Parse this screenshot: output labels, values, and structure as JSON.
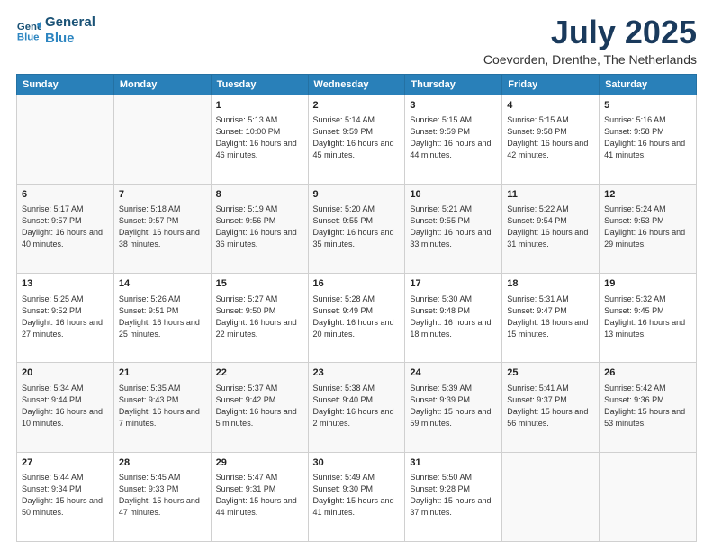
{
  "logo": {
    "line1": "General",
    "line2": "Blue"
  },
  "title": "July 2025",
  "subtitle": "Coevorden, Drenthe, The Netherlands",
  "days_header": [
    "Sunday",
    "Monday",
    "Tuesday",
    "Wednesday",
    "Thursday",
    "Friday",
    "Saturday"
  ],
  "weeks": [
    [
      {
        "day": "",
        "content": ""
      },
      {
        "day": "",
        "content": ""
      },
      {
        "day": "1",
        "content": "Sunrise: 5:13 AM\nSunset: 10:00 PM\nDaylight: 16 hours and 46 minutes."
      },
      {
        "day": "2",
        "content": "Sunrise: 5:14 AM\nSunset: 9:59 PM\nDaylight: 16 hours and 45 minutes."
      },
      {
        "day": "3",
        "content": "Sunrise: 5:15 AM\nSunset: 9:59 PM\nDaylight: 16 hours and 44 minutes."
      },
      {
        "day": "4",
        "content": "Sunrise: 5:15 AM\nSunset: 9:58 PM\nDaylight: 16 hours and 42 minutes."
      },
      {
        "day": "5",
        "content": "Sunrise: 5:16 AM\nSunset: 9:58 PM\nDaylight: 16 hours and 41 minutes."
      }
    ],
    [
      {
        "day": "6",
        "content": "Sunrise: 5:17 AM\nSunset: 9:57 PM\nDaylight: 16 hours and 40 minutes."
      },
      {
        "day": "7",
        "content": "Sunrise: 5:18 AM\nSunset: 9:57 PM\nDaylight: 16 hours and 38 minutes."
      },
      {
        "day": "8",
        "content": "Sunrise: 5:19 AM\nSunset: 9:56 PM\nDaylight: 16 hours and 36 minutes."
      },
      {
        "day": "9",
        "content": "Sunrise: 5:20 AM\nSunset: 9:55 PM\nDaylight: 16 hours and 35 minutes."
      },
      {
        "day": "10",
        "content": "Sunrise: 5:21 AM\nSunset: 9:55 PM\nDaylight: 16 hours and 33 minutes."
      },
      {
        "day": "11",
        "content": "Sunrise: 5:22 AM\nSunset: 9:54 PM\nDaylight: 16 hours and 31 minutes."
      },
      {
        "day": "12",
        "content": "Sunrise: 5:24 AM\nSunset: 9:53 PM\nDaylight: 16 hours and 29 minutes."
      }
    ],
    [
      {
        "day": "13",
        "content": "Sunrise: 5:25 AM\nSunset: 9:52 PM\nDaylight: 16 hours and 27 minutes."
      },
      {
        "day": "14",
        "content": "Sunrise: 5:26 AM\nSunset: 9:51 PM\nDaylight: 16 hours and 25 minutes."
      },
      {
        "day": "15",
        "content": "Sunrise: 5:27 AM\nSunset: 9:50 PM\nDaylight: 16 hours and 22 minutes."
      },
      {
        "day": "16",
        "content": "Sunrise: 5:28 AM\nSunset: 9:49 PM\nDaylight: 16 hours and 20 minutes."
      },
      {
        "day": "17",
        "content": "Sunrise: 5:30 AM\nSunset: 9:48 PM\nDaylight: 16 hours and 18 minutes."
      },
      {
        "day": "18",
        "content": "Sunrise: 5:31 AM\nSunset: 9:47 PM\nDaylight: 16 hours and 15 minutes."
      },
      {
        "day": "19",
        "content": "Sunrise: 5:32 AM\nSunset: 9:45 PM\nDaylight: 16 hours and 13 minutes."
      }
    ],
    [
      {
        "day": "20",
        "content": "Sunrise: 5:34 AM\nSunset: 9:44 PM\nDaylight: 16 hours and 10 minutes."
      },
      {
        "day": "21",
        "content": "Sunrise: 5:35 AM\nSunset: 9:43 PM\nDaylight: 16 hours and 7 minutes."
      },
      {
        "day": "22",
        "content": "Sunrise: 5:37 AM\nSunset: 9:42 PM\nDaylight: 16 hours and 5 minutes."
      },
      {
        "day": "23",
        "content": "Sunrise: 5:38 AM\nSunset: 9:40 PM\nDaylight: 16 hours and 2 minutes."
      },
      {
        "day": "24",
        "content": "Sunrise: 5:39 AM\nSunset: 9:39 PM\nDaylight: 15 hours and 59 minutes."
      },
      {
        "day": "25",
        "content": "Sunrise: 5:41 AM\nSunset: 9:37 PM\nDaylight: 15 hours and 56 minutes."
      },
      {
        "day": "26",
        "content": "Sunrise: 5:42 AM\nSunset: 9:36 PM\nDaylight: 15 hours and 53 minutes."
      }
    ],
    [
      {
        "day": "27",
        "content": "Sunrise: 5:44 AM\nSunset: 9:34 PM\nDaylight: 15 hours and 50 minutes."
      },
      {
        "day": "28",
        "content": "Sunrise: 5:45 AM\nSunset: 9:33 PM\nDaylight: 15 hours and 47 minutes."
      },
      {
        "day": "29",
        "content": "Sunrise: 5:47 AM\nSunset: 9:31 PM\nDaylight: 15 hours and 44 minutes."
      },
      {
        "day": "30",
        "content": "Sunrise: 5:49 AM\nSunset: 9:30 PM\nDaylight: 15 hours and 41 minutes."
      },
      {
        "day": "31",
        "content": "Sunrise: 5:50 AM\nSunset: 9:28 PM\nDaylight: 15 hours and 37 minutes."
      },
      {
        "day": "",
        "content": ""
      },
      {
        "day": "",
        "content": ""
      }
    ]
  ]
}
